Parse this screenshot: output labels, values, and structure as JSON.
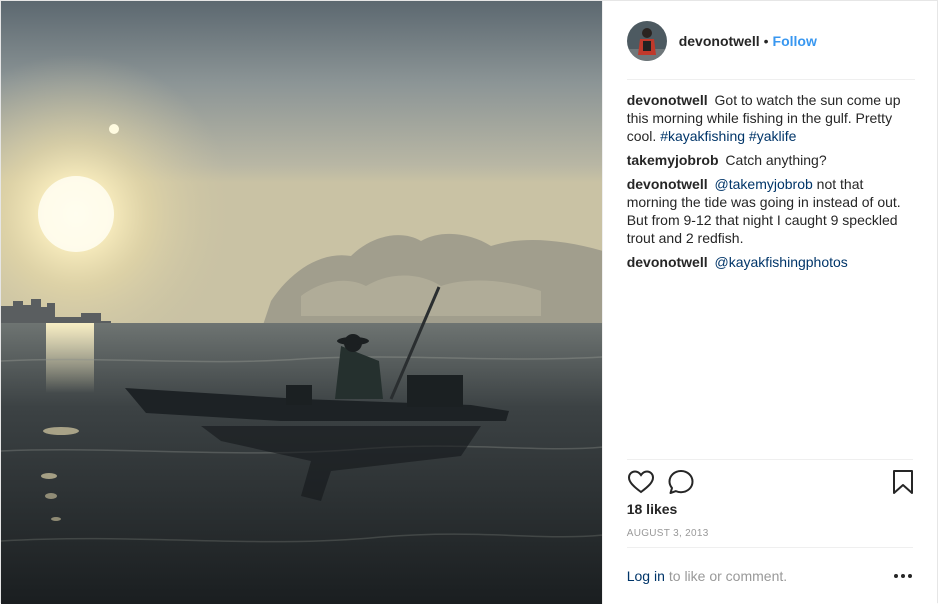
{
  "header": {
    "username": "devonotwell",
    "separator": "•",
    "follow_label": "Follow"
  },
  "comments": [
    {
      "user": "devonotwell",
      "text": "Got to watch the sun come up this morning while fishing in the gulf. Pretty cool.",
      "tags": [
        "#kayakfishing",
        "#yaklife"
      ]
    },
    {
      "user": "takemyjobrob",
      "text": "Catch anything?"
    },
    {
      "user": "devonotwell",
      "mention": "@takemyjobrob",
      "text": "not that morning the tide was going in instead of out. But from 9-12 that night I caught 9 speckled trout and 2 redfish."
    },
    {
      "user": "devonotwell",
      "mention": "@kayakfishingphotos"
    }
  ],
  "actions": {
    "like_icon": "heart-icon",
    "comment_icon": "comment-bubble-icon",
    "save_icon": "bookmark-icon"
  },
  "likes": "18 likes",
  "date": "AUGUST 3, 2013",
  "footer": {
    "login_label": "Log in",
    "text": "to like or comment.",
    "more_icon": "ellipsis-icon"
  },
  "colors": {
    "link_blue": "#3897f0",
    "text_link": "#003569",
    "muted": "#999999",
    "text": "#262626"
  }
}
